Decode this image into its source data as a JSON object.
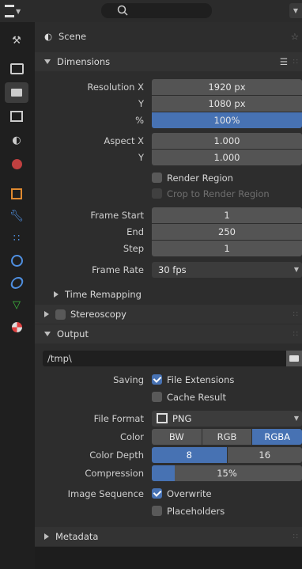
{
  "header": {
    "context": "Scene"
  },
  "dimensions": {
    "title": "Dimensions",
    "resolution_x_label": "Resolution X",
    "resolution_x": "1920 px",
    "resolution_y_label": "Y",
    "resolution_y": "1080 px",
    "resolution_pct_label": "%",
    "resolution_pct": "100%",
    "aspect_x_label": "Aspect X",
    "aspect_x": "1.000",
    "aspect_y_label": "Y",
    "aspect_y": "1.000",
    "render_region": "Render Region",
    "crop_region": "Crop to Render Region",
    "frame_start_label": "Frame Start",
    "frame_start": "1",
    "frame_end_label": "End",
    "frame_end": "250",
    "frame_step_label": "Step",
    "frame_step": "1",
    "frame_rate_label": "Frame Rate",
    "frame_rate": "30 fps",
    "time_remapping": "Time Remapping"
  },
  "stereoscopy": {
    "title": "Stereoscopy"
  },
  "output": {
    "title": "Output",
    "path": "/tmp\\",
    "saving_label": "Saving",
    "file_extensions": "File Extensions",
    "cache_result": "Cache Result",
    "file_format_label": "File Format",
    "file_format": "PNG",
    "color_label": "Color",
    "color_options": [
      "BW",
      "RGB",
      "RGBA"
    ],
    "color_selected": "RGBA",
    "color_depth_label": "Color Depth",
    "depth_options": [
      "8",
      "16"
    ],
    "depth_selected": "8",
    "compression_label": "Compression",
    "compression": "15%",
    "compression_fraction": 0.15,
    "image_sequence_label": "Image Sequence",
    "overwrite": "Overwrite",
    "placeholders": "Placeholders"
  },
  "metadata": {
    "title": "Metadata"
  },
  "colors": {
    "accent": "#4772b3",
    "field": "#545454",
    "panel": "#2d2d2d"
  }
}
